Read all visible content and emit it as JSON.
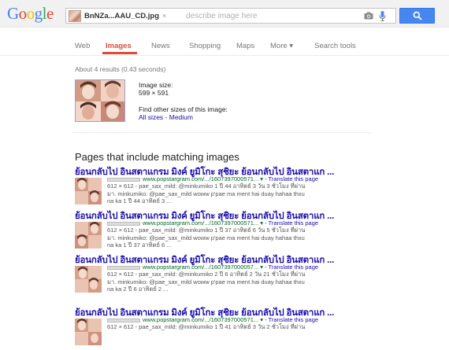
{
  "header": {
    "logo_letters": [
      {
        "ch": "G",
        "color": "#4285f4"
      },
      {
        "ch": "o",
        "color": "#ea4335"
      },
      {
        "ch": "o",
        "color": "#fbbc05"
      },
      {
        "ch": "g",
        "color": "#4285f4"
      },
      {
        "ch": "l",
        "color": "#34a853"
      },
      {
        "ch": "e",
        "color": "#ea4335"
      }
    ],
    "search_chip_filename": "BnNZa...AAU_CD.jpg",
    "search_chip_close": "×",
    "search_placeholder": "describe image here",
    "camera_icon": "camera-icon",
    "mic_icon": "microphone-icon",
    "search_icon": "search-icon",
    "search_button_color": "#4787ed"
  },
  "tabs": [
    {
      "label": "Web",
      "active": false
    },
    {
      "label": "Images",
      "active": true
    },
    {
      "label": "News",
      "active": false
    },
    {
      "label": "Shopping",
      "active": false
    },
    {
      "label": "Maps",
      "active": false
    },
    {
      "label": "More ▾",
      "active": false
    },
    {
      "label": "Search tools",
      "active": false
    }
  ],
  "stats": "About 4 results (0.43 seconds)",
  "image_info": {
    "size_label": "Image size:",
    "size_value": "599 × 591",
    "find_other": "Find other sizes of this image:",
    "all_sizes": "All sizes",
    "separator": " - ",
    "medium": "Medium"
  },
  "section_title": "Pages that include matching images",
  "results": [
    {
      "title": "ย้อนกลับไป อินสตาแกรม มิงค์ ยูมิโกะ สุชิยะ ย้อนกลับไป อินสตาแก ...",
      "url": "www.popstargram.com/.../1607397000571...",
      "translate": " - Translate this page",
      "snippet_1": "612 × 612 - pae_sax_mild: @minkumiko 1 ปี 44 อาทิตย์ 3 วัน 3 ชั่วโมง ที่ผ่าน",
      "snippet_2": "มา. minkumiko: @pae_sax_mild woww p'pae ma ment hai duay hahaa thxu",
      "snippet_3": "na ka 1 ปี 44 อาทิตย์ 3 ..."
    },
    {
      "title": "ย้อนกลับไป อินสตาแกรม มิงค์ ยูมิโกะ สุชิยะ ย้อนกลับไป อินสตาแก ...",
      "url": "www.popstargram.com/.../1607397000571...",
      "translate": " - Translate this page",
      "snippet_1": "612 × 612 - pae_sax_mild: @minkumiko 1 ปี 37 อาทิตย์ 6 วัน 5 ชั่วโมง ที่ผ่าน",
      "snippet_2": "มา. minkumiko: @pae_sax_mild woww p'pae ma ment hai duay hahaa thxu",
      "snippet_3": "na ka 1 ปี 37 อาทิตย์ 6 ..."
    },
    {
      "title": "ย้อนกลับไป อินสตาแกรม มิงค์ ยูมิโกะ สุชิยะ ย้อนกลับไป อินสตาแก ...",
      "url": "www.popstargram.com/.../1607397000057...",
      "translate": " - Translate this page",
      "snippet_1": "612 × 612 - pae_sax_mild: @minkumiko 2 ปี 6 อาทิตย์ 2 วัน 21 ชั่วโมง ที่ผ่าน",
      "snippet_2": "มา. minkumiko: @pae_sax_mild woww p'pae ma ment hai duay hahaa thxu",
      "snippet_3": "na ka 2 ปี 6 อาทิตย์ 2 ..."
    },
    {
      "title": "ย้อนกลับไป อินสตาแกรม มิงค์ ยูมิโกะ สุชิยะ ย้อนกลับไป อินสตาแก ...",
      "url": "www.popstargram.com/.../1607397000571...",
      "translate": " - Translate this page",
      "snippet_1": "612 × 612 - pae_sax_mild: @minkumiko 1 ปี 41 อาทิตย์ 3 วัน 2 ชั่วโมง ที่ผ่าน",
      "snippet_2": "",
      "snippet_3": ""
    }
  ]
}
